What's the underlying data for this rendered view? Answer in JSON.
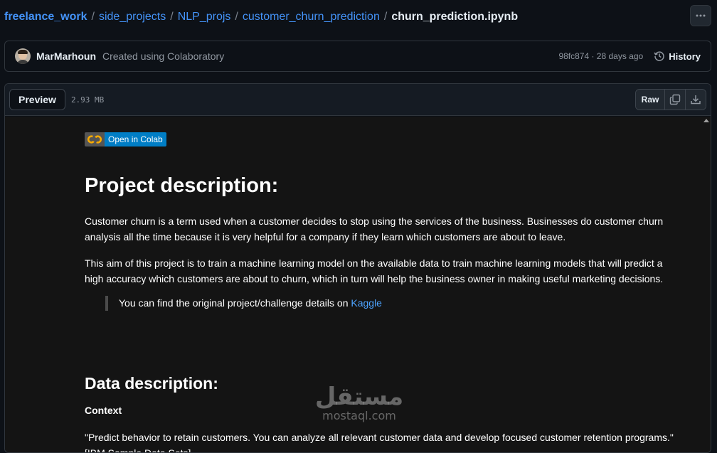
{
  "breadcrumb": {
    "segments": [
      "freelance_work",
      "side_projects",
      "NLP_projs",
      "customer_churn_prediction"
    ],
    "separator": "/",
    "file": "churn_prediction.ipynb"
  },
  "commit": {
    "author": "MarMarhoun",
    "message": "Created using Colaboratory",
    "meta": "98fc874 · 28 days ago",
    "history_label": "History"
  },
  "file_header": {
    "preview_label": "Preview",
    "size": "2.93 MB",
    "raw_label": "Raw"
  },
  "notebook": {
    "badge_text": "Open in Colab",
    "heading1": "Project description:",
    "para1": "Customer churn is a term used when a customer decides to stop using the services of the business. Businesses do customer churn analysis all the time because it is very helpful for a company if they learn which customers are about to leave.",
    "para2": "This aim of this project is to train a machine learning model on the available data to train machine learning models that will predict a high accuracy which customers are about to churn, which in turn will help the business owner in making useful marketing decisions.",
    "quote_text": "You can find the original project/challenge details on ",
    "quote_link": "Kaggle",
    "heading2": "Data description:",
    "context_label": "Context",
    "para3": "\"Predict behavior to retain customers. You can analyze all relevant customer data and develop focused customer retention programs.\" [IBM Sample Data Sets]"
  },
  "watermark": {
    "arabic": "مستقل",
    "latin": "mostaql.com"
  },
  "colors": {
    "link": "#4493f8",
    "badge_blue": "#007ec6",
    "page_bg": "#0d1117",
    "notebook_bg": "#141414"
  }
}
